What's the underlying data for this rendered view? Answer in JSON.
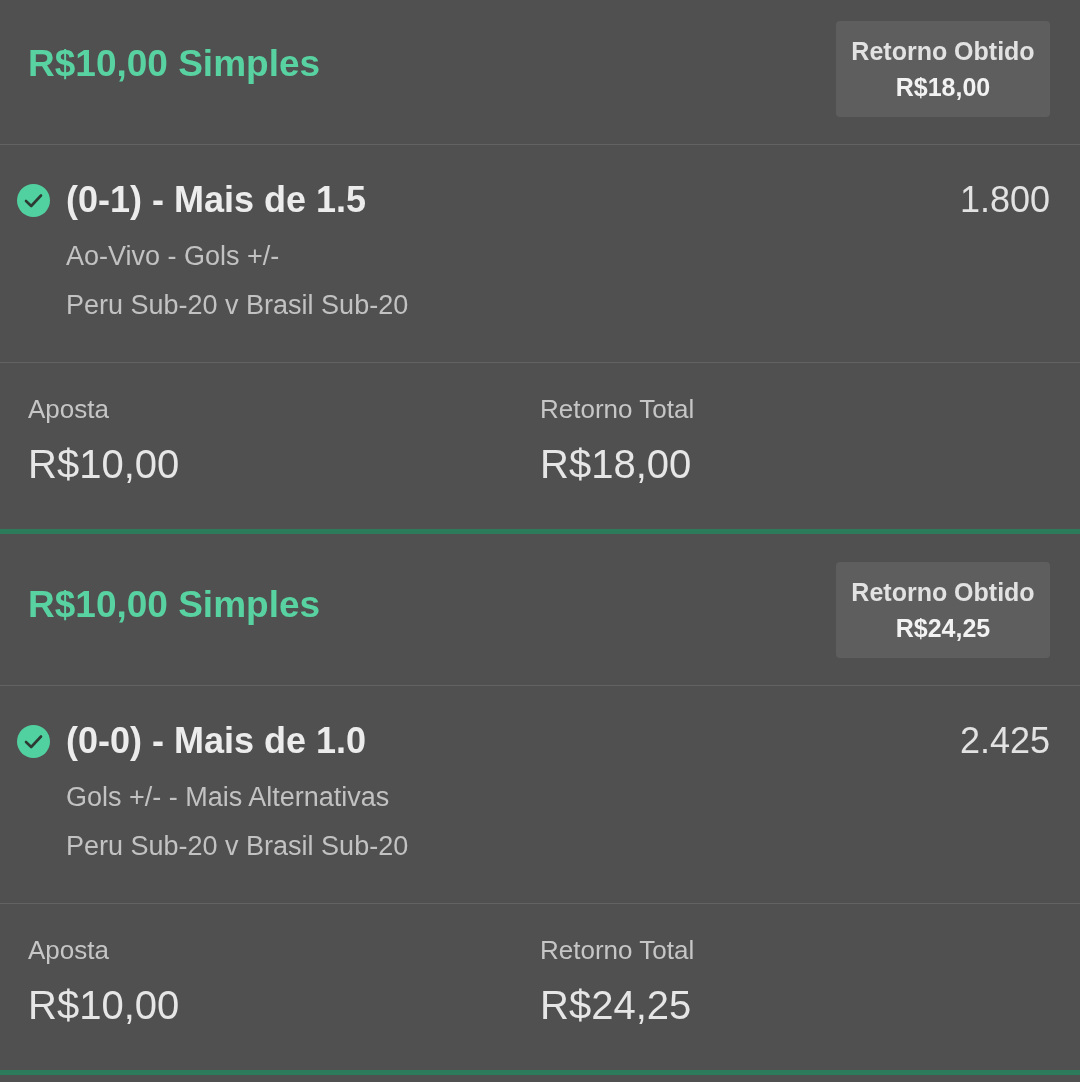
{
  "bets": [
    {
      "title": "R$10,00 Simples",
      "returned": {
        "label": "Retorno Obtido",
        "value": "R$18,00"
      },
      "selections": [
        {
          "won": true,
          "name": "(0-1) - Mais de 1.5",
          "odds": "1.800",
          "market": "Ao-Vivo - Gols +/-",
          "event": "Peru Sub-20 v Brasil Sub-20"
        }
      ],
      "stake": {
        "label": "Aposta",
        "value": "R$10,00"
      },
      "total_return": {
        "label": "Retorno Total",
        "value": "R$18,00"
      }
    },
    {
      "title": "R$10,00 Simples",
      "returned": {
        "label": "Retorno Obtido",
        "value": "R$24,25"
      },
      "selections": [
        {
          "won": true,
          "name": "(0-0) - Mais de 1.0",
          "odds": "2.425",
          "market": "Gols +/- - Mais Alternativas",
          "event": "Peru Sub-20 v Brasil Sub-20"
        }
      ],
      "stake": {
        "label": "Aposta",
        "value": "R$10,00"
      },
      "total_return": {
        "label": "Retorno Total",
        "value": "R$24,25"
      }
    }
  ]
}
